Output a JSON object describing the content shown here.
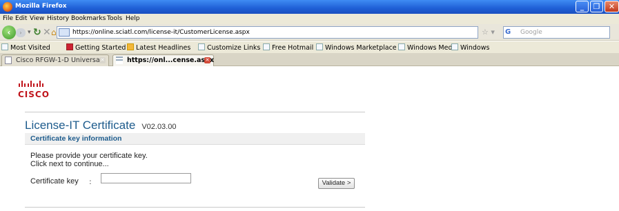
{
  "window": {
    "title": "Mozilla Firefox",
    "controls": {
      "minimize": "_",
      "maximize": "❐",
      "close": "✕"
    }
  },
  "menu": [
    "File",
    "Edit",
    "View",
    "History",
    "Bookmarks",
    "Tools",
    "Help"
  ],
  "nav": {
    "url": "https://online.sciatl.com/license-it/CustomerLicense.aspx",
    "search_placeholder": "Google",
    "search_engine": "G"
  },
  "bookmarks": [
    "Most Visited",
    "Getting Started",
    "Latest Headlines",
    "Customize Links",
    "Free Hotmail",
    "Windows Marketplace",
    "Windows Media",
    "Windows"
  ],
  "tabs": [
    {
      "label": "Cisco RFGW-1-D Universa...",
      "active": false
    },
    {
      "label": "https://onl...cense.aspx",
      "active": true
    }
  ],
  "page": {
    "logo_text": "CISCO",
    "title": "License-IT Certificate",
    "version": "V02.03.00",
    "section_title": "Certificate key information",
    "instruction_1": "Please provide your certificate key.",
    "instruction_2": "Click next to continue...",
    "key_label": "Certificate key",
    "key_colon": ":",
    "key_value": "",
    "validate_button": "Validate >"
  },
  "colors": {
    "titlebar": "#1f5fd6",
    "heading_blue": "#1d5b8c",
    "cisco_red": "#c0141b",
    "chrome_bg": "#ece9d8"
  }
}
